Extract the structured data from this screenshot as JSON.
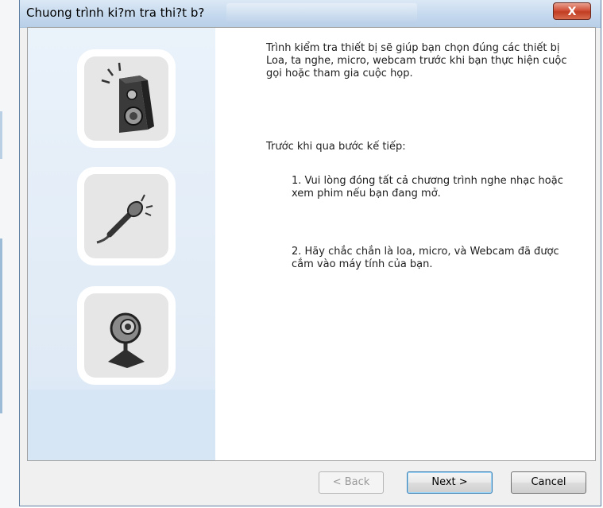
{
  "window": {
    "title": "Chuong trình ki?m tra thi?t b?",
    "close_label": "X"
  },
  "icons": [
    {
      "name": "speaker-icon"
    },
    {
      "name": "microphone-icon"
    },
    {
      "name": "webcam-icon"
    }
  ],
  "content": {
    "intro": "Trình kiểm tra thiết bị sẽ giúp bạn chọn đúng các thiết bị Loa, ta nghe, micro, webcam trước khi bạn thực hiện cuộc gọi hoặc tham gia cuộc họp.",
    "before_heading": "Trước khi qua bước kế tiếp:",
    "step1": "1. Vui lòng đóng tất cả chương trình nghe nhạc hoặc xem phim nếu bạn đang mở.",
    "step2": "2. Hãy chắc chắn là loa, micro, và Webcam đã được cắm vào máy tính của bạn."
  },
  "buttons": {
    "back": "< Back",
    "next": "Next >",
    "cancel": "Cancel"
  },
  "colors": {
    "side_panel": "#e6effa",
    "titlebar": "#c5d9ee",
    "close_button": "#c9452b"
  }
}
